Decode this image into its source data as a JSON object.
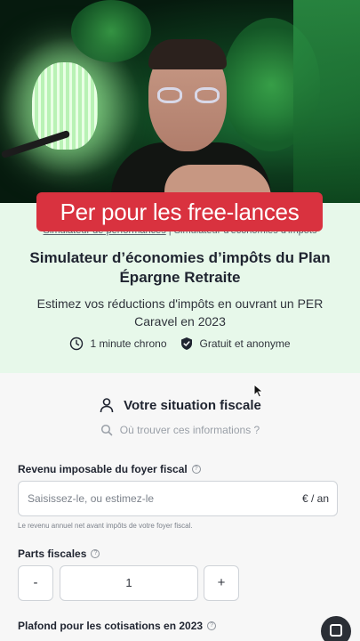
{
  "video": {
    "caption": "Per pour les free-lances"
  },
  "hero": {
    "breadcrumb_link": "Simulateur de performances",
    "breadcrumb_sep": "|",
    "breadcrumb_current": "Simulateur d'économies d'impôts",
    "title": "Simulateur d’économies d’impôts du Plan Épargne Retraite",
    "subtitle": "Estimez vos réductions d'impôts en ouvrant un PER Caravel en 2023",
    "badges": [
      {
        "icon": "clock-icon",
        "label": "1 minute chrono"
      },
      {
        "icon": "shield-check-icon",
        "label": "Gratuit et anonyme"
      }
    ]
  },
  "form": {
    "section_title": "Votre situation fiscale",
    "help_link": "Où trouver ces informations ?",
    "revenu": {
      "label": "Revenu imposable du foyer fiscal",
      "placeholder": "Saisissez-le, ou estimez-le",
      "value": "",
      "unit": "€ / an",
      "hint": "Le revenu annuel net avant impôts de votre foyer fiscal."
    },
    "parts": {
      "label": "Parts fiscales",
      "minus": "-",
      "value": "1",
      "plus": "+"
    },
    "plafond": {
      "label": "Plafond pour les cotisations en 2023"
    }
  },
  "colors": {
    "caption_bg": "#d9323f",
    "hero_bg": "#e7f8ea",
    "form_bg": "#f7f7f7"
  }
}
